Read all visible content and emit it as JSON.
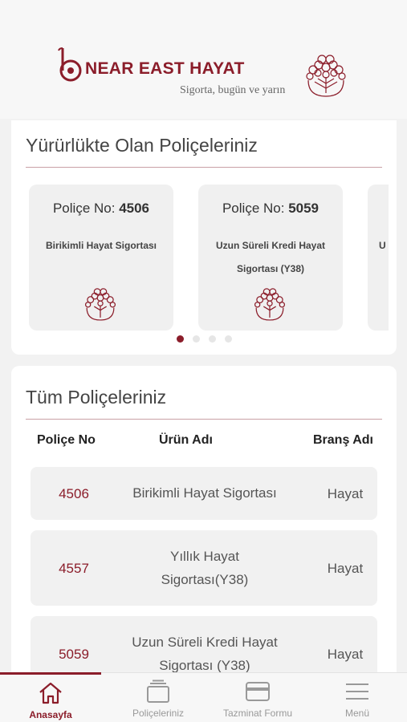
{
  "header": {
    "brand": "NEAR EAST HAYAT",
    "slogan": "Sigorta, bugün ve yarın"
  },
  "active_policies": {
    "title": "Yürürlükte Olan Poliçeleriniz",
    "no_label": "Poliçe No:",
    "cards": [
      {
        "no": "4506",
        "product": "Birikimli Hayat Sigortası"
      },
      {
        "no": "5059",
        "product": "Uzun Süreli Kredi Hayat Sigortası (Y38)"
      },
      {
        "no": "",
        "product": "U"
      }
    ],
    "pager": {
      "count": 4,
      "active_index": 0
    }
  },
  "all_policies": {
    "title": "Tüm Poliçeleriniz",
    "columns": {
      "no": "Poliçe No",
      "product": "Ürün Adı",
      "branch": "Branş Adı"
    },
    "rows": [
      {
        "no": "4506",
        "product": "Birikimli Hayat Sigortası",
        "branch": "Hayat"
      },
      {
        "no": "4557",
        "product": "Yıllık Hayat Sigortası(Y38)",
        "branch": "Hayat"
      },
      {
        "no": "5059",
        "product": "Uzun Süreli Kredi Hayat Sigortası (Y38)",
        "branch": "Hayat"
      }
    ]
  },
  "tabbar": {
    "items": [
      {
        "label": "Anasayfa",
        "icon": "home-icon",
        "active": true
      },
      {
        "label": "Poliçeleriniz",
        "icon": "policies-icon",
        "active": false
      },
      {
        "label": "Tazminat Formu",
        "icon": "card-icon",
        "active": false
      },
      {
        "label": "Menü",
        "icon": "menu-icon",
        "active": false
      }
    ]
  },
  "colors": {
    "brand": "#8b1d2a",
    "background": "#f2f2f2",
    "card": "#ffffff"
  }
}
